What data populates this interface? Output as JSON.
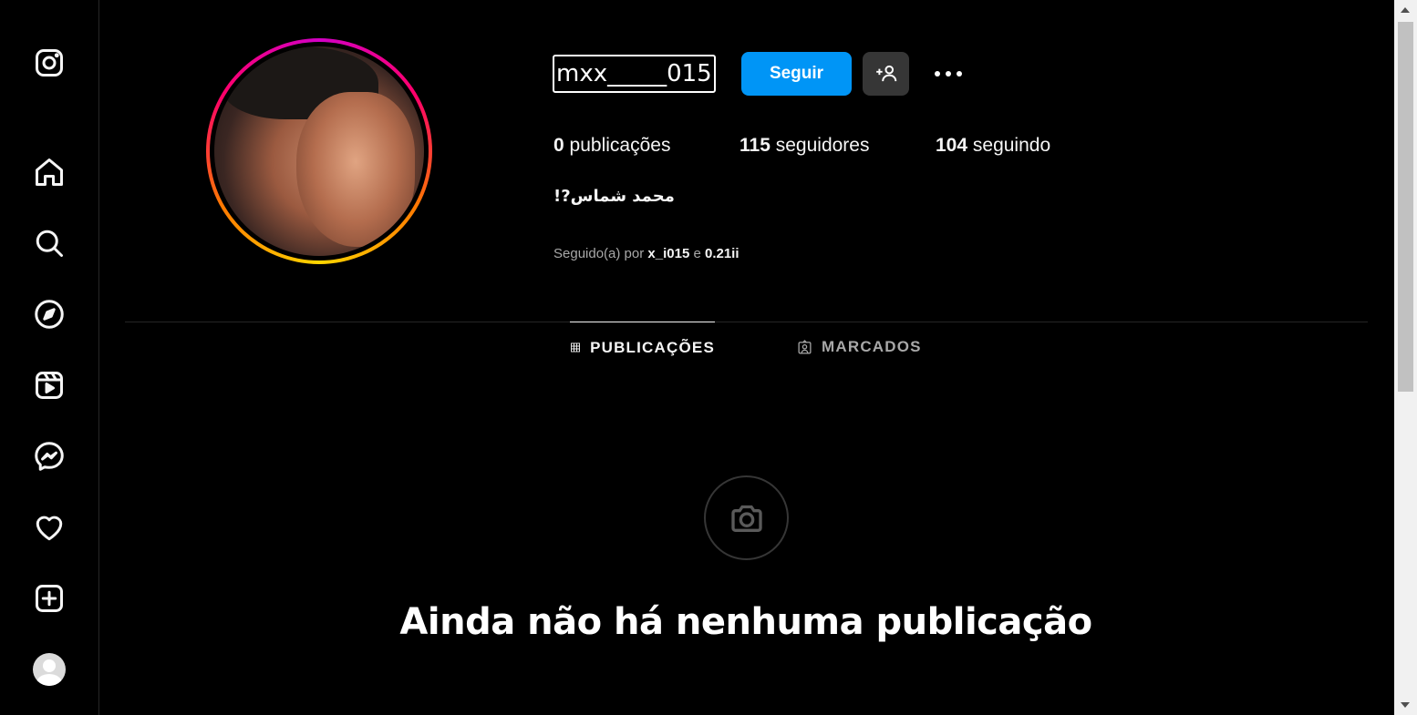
{
  "sidebar": {
    "items": [
      {
        "icon": "instagram-logo-icon"
      },
      {
        "icon": "home-icon"
      },
      {
        "icon": "search-icon"
      },
      {
        "icon": "explore-compass-icon"
      },
      {
        "icon": "reels-icon"
      },
      {
        "icon": "messenger-icon"
      },
      {
        "icon": "heart-icon"
      },
      {
        "icon": "create-plus-icon"
      },
      {
        "icon": "profile-avatar"
      }
    ]
  },
  "profile": {
    "username": "mxx_____015",
    "follow_button": "Seguir",
    "stats": {
      "posts_count": "0",
      "posts_label": "publicações",
      "followers_count": "115",
      "followers_label": "seguidores",
      "following_count": "104",
      "following_label": "seguindo"
    },
    "full_name": "محمد شماس?!",
    "followed_by": {
      "prefix": "Seguido(a) por",
      "user1": "x_i015",
      "conjunction": "e",
      "user2": "0.21ii"
    }
  },
  "tabs": [
    {
      "label": "PUBLICAÇÕES",
      "icon": "grid-icon",
      "active": true
    },
    {
      "label": "MARCADOS",
      "icon": "tagged-icon",
      "active": false
    }
  ],
  "empty_state": {
    "icon": "camera-icon",
    "title": "Ainda não há nenhuma publicação"
  },
  "colors": {
    "background": "#000000",
    "accent": "#0095f6",
    "secondary_button": "#363636",
    "muted_text": "#a8a8a8"
  }
}
